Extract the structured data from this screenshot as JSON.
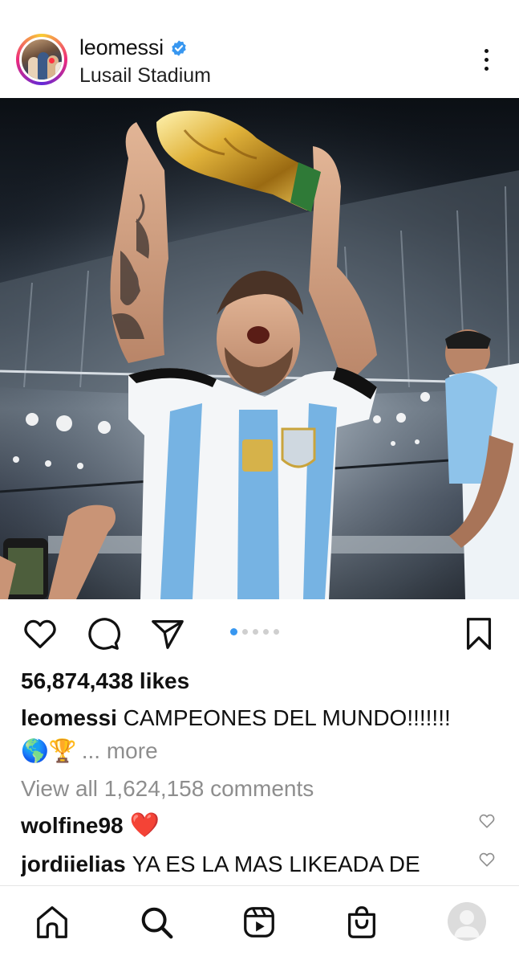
{
  "post": {
    "username": "leomessi",
    "verified": true,
    "location": "Lusail Stadium",
    "carousel": {
      "total_slides": 5,
      "active_slide": 1
    },
    "likes_text": "56,874,438 likes",
    "caption": {
      "username": "leomessi",
      "text": "CAMPEONES DEL MUNDO!!!!!!!",
      "emoji": "🌎🏆",
      "more_label": "... more"
    },
    "view_comments_label": "View all 1,624,158 comments",
    "comments": [
      {
        "username": "wolfine98",
        "text": "❤️"
      },
      {
        "username": "jordiielias",
        "text": "YA ES LA MAS LIKEADA DE"
      }
    ]
  },
  "icons": {
    "header": [
      "verified-badge-icon",
      "more-options-icon"
    ],
    "actions": [
      "like-icon",
      "comment-icon",
      "share-icon",
      "save-icon"
    ],
    "bottom_nav": [
      "home-icon",
      "search-icon",
      "reels-icon",
      "shop-icon",
      "profile-icon"
    ]
  },
  "colors": {
    "verified_blue": "#3897f0",
    "active_dot": "#3897f0",
    "heart_red": "#e0172a",
    "muted_text": "#8e8e8e",
    "notification_dot": "#ff3040"
  }
}
